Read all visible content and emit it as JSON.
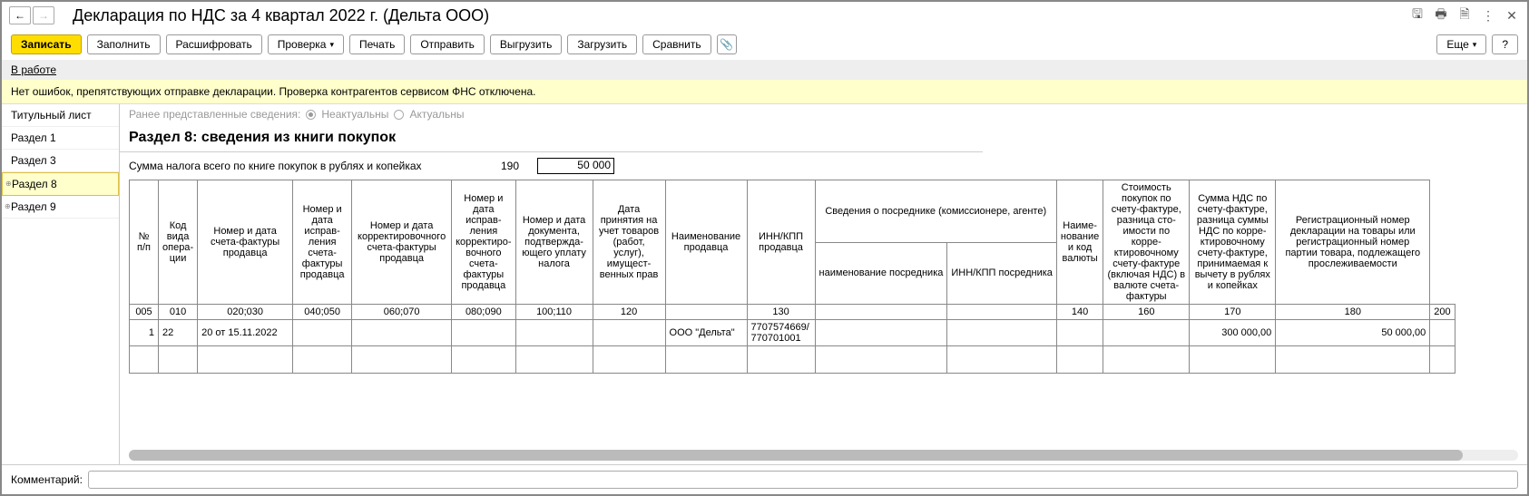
{
  "title": "Декларация по НДС за 4 квартал 2022 г. (Дельта ООО)",
  "toolbar": {
    "write": "Записать",
    "fill": "Заполнить",
    "expand": "Расшифровать",
    "check": "Проверка",
    "print": "Печать",
    "send": "Отправить",
    "unload": "Выгрузить",
    "load": "Загрузить",
    "compare": "Сравнить",
    "more": "Еще",
    "help": "?"
  },
  "status": {
    "text": "В работе"
  },
  "info": "Нет ошибок, препятствующих отправке декларации. Проверка контрагентов сервисом ФНС отключена.",
  "sidebar": {
    "items": [
      "Титульный лист",
      "Раздел 1",
      "Раздел 3",
      "Раздел 8",
      "Раздел 9"
    ]
  },
  "radio": {
    "label": "Ранее представленные сведения:",
    "opt1": "Неактуальны",
    "opt2": "Актуальны"
  },
  "section": {
    "title": "Раздел 8: сведения из книги покупок"
  },
  "sum": {
    "label": "Сумма налога всего по книге покупок в рублях и копейках",
    "code": "190",
    "value": "50 000"
  },
  "table": {
    "headers": {
      "c1": "№ п/п",
      "c2": "Код вида опера­ции",
      "c3": "Номер и дата счета-фактуры продавца",
      "c4": "Номер и дата исправ­ления счета-фактуры продавца",
      "c5": "Номер и дата корректировочного счета-фактуры продавца",
      "c6": "Номер и дата исправ­ления корректиро­вочного счета-фактуры продавца",
      "c7": "Номер и дата документа, подтвержда­ющего уплату налога",
      "c8": "Дата принятия на учет товаров (работ, услуг), имущест­венных прав",
      "c9": "Наименование продавца",
      "c10": "ИНН/КПП продавца",
      "c11": "Сведения о посреднике (комиссионере, агенте)",
      "c11a": "наименование посредника",
      "c11b": "ИНН/КПП посредника",
      "c12": "Наиме­нование и код валюты",
      "c13": "Стоимость покупок по счету-фактуре, разница сто­имости по корре­ктировочному счету-фактуре (включая НДС) в валюте счета-фактуры",
      "c14": "Сумма НДС по счету-фактуре, разница суммы НДС по корре­ктировочному счету-фактуре, принимаемая к вычету в рублях и копейках",
      "c15": "Регистрационный номер декларации на товары или регистрационный номер партии товара, подлежащего прослеживаемости"
    },
    "codes": [
      "005",
      "010",
      "020;030",
      "040;050",
      "060;070",
      "080;090",
      "100;110",
      "120",
      "",
      "130",
      "",
      "",
      "140",
      "160",
      "170",
      "180",
      "200"
    ],
    "row1": {
      "n": "1",
      "op": "22",
      "sf": "20 от 15.11.2022",
      "seller": "ООО \"Дельта\"",
      "inn": "7707574669/\n770701001",
      "cost": "300 000,00",
      "nds": "50 000,00"
    }
  },
  "footer": {
    "label": "Комментарий:"
  }
}
